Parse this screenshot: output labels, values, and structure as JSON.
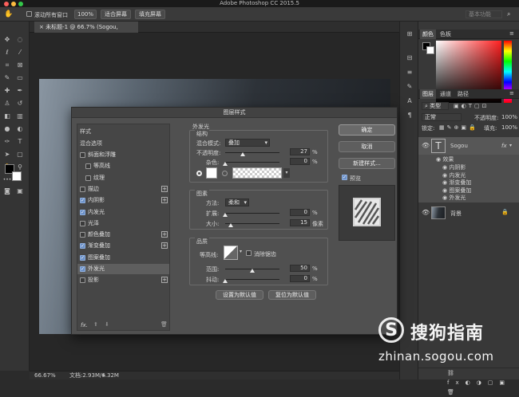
{
  "window": {
    "title": "Adobe Photoshop CC 2015.5"
  },
  "options_bar": {
    "scroll_all_windows_label": "滚动所有窗口",
    "zoom_100_label": "100%",
    "fit_screen_label": "适合屏幕",
    "fill_screen_label": "填充屏幕",
    "workspace_label": "基本功能"
  },
  "document": {
    "tab_title": "未标题-1 @ 66.7% (Sogou, RGB/8*) *",
    "tab_close": "×"
  },
  "status": {
    "zoom": "66.67%",
    "doc_size": "文档:2.93M/6.32M"
  },
  "colors": {
    "foreground": "#000000",
    "background": "#ffffff",
    "accent": "#6a8fc6"
  },
  "color_panel": {
    "tabs": [
      "颜色",
      "色板"
    ]
  },
  "layers_panel": {
    "tabs": [
      "图层",
      "通道",
      "路径"
    ],
    "kind_filter": "类型",
    "blend_mode": "正常",
    "opacity_label": "不透明度:",
    "opacity_value": "100%",
    "lock_label": "锁定:",
    "fill_label": "填充:",
    "fill_value": "100%",
    "text_layer": {
      "name": "Sogou",
      "fx_label": "fx",
      "effects_label": "效果",
      "effects": [
        "内阴影",
        "内发光",
        "渐变叠加",
        "图案叠加",
        "外发光"
      ]
    },
    "background_layer": {
      "name": "背景"
    }
  },
  "dialog": {
    "title": "图层样式",
    "styles_header": "样式",
    "blend_options": "混合选项",
    "styles": [
      {
        "label": "斜面和浮雕",
        "checked": false,
        "plus": false,
        "indent": false
      },
      {
        "label": "等高线",
        "checked": false,
        "plus": false,
        "indent": true
      },
      {
        "label": "纹理",
        "checked": false,
        "plus": false,
        "indent": true
      },
      {
        "label": "描边",
        "checked": false,
        "plus": true,
        "indent": false
      },
      {
        "label": "内阴影",
        "checked": true,
        "plus": true,
        "indent": false
      },
      {
        "label": "内发光",
        "checked": true,
        "plus": false,
        "indent": false
      },
      {
        "label": "光泽",
        "checked": false,
        "plus": false,
        "indent": false
      },
      {
        "label": "颜色叠加",
        "checked": false,
        "plus": true,
        "indent": false
      },
      {
        "label": "渐变叠加",
        "checked": true,
        "plus": true,
        "indent": false
      },
      {
        "label": "图案叠加",
        "checked": true,
        "plus": false,
        "indent": false
      },
      {
        "label": "外发光",
        "checked": true,
        "plus": false,
        "indent": false
      },
      {
        "label": "投影",
        "checked": false,
        "plus": true,
        "indent": false
      }
    ],
    "selected_style": "外发光",
    "fx_label": "fx.",
    "outer_glow": {
      "title": "外发光",
      "structure": {
        "title": "结构",
        "blend_mode_label": "混合模式:",
        "blend_mode": "叠加",
        "opacity_label": "不透明度:",
        "opacity": "27",
        "noise_label": "杂色:",
        "noise": "0",
        "percent": "%"
      },
      "elements": {
        "title": "图素",
        "technique_label": "方法:",
        "technique": "柔和",
        "spread_label": "扩展:",
        "spread": "0",
        "size_label": "大小:",
        "size": "15",
        "size_unit": "像素",
        "percent": "%"
      },
      "quality": {
        "title": "品质",
        "contour_label": "等高线:",
        "anti_alias_label": "消除锯齿",
        "range_label": "范围:",
        "range": "50",
        "jitter_label": "抖动:",
        "jitter": "0",
        "percent": "%"
      },
      "make_default_label": "设置为默认值",
      "reset_default_label": "复位为默认值"
    },
    "ok_label": "确定",
    "cancel_label": "取消",
    "new_style_label": "新建样式...",
    "preview_label": "预览"
  },
  "watermark": {
    "logo_text": "S",
    "name": "搜狗指南",
    "url": "zhinan.sogou.com"
  }
}
